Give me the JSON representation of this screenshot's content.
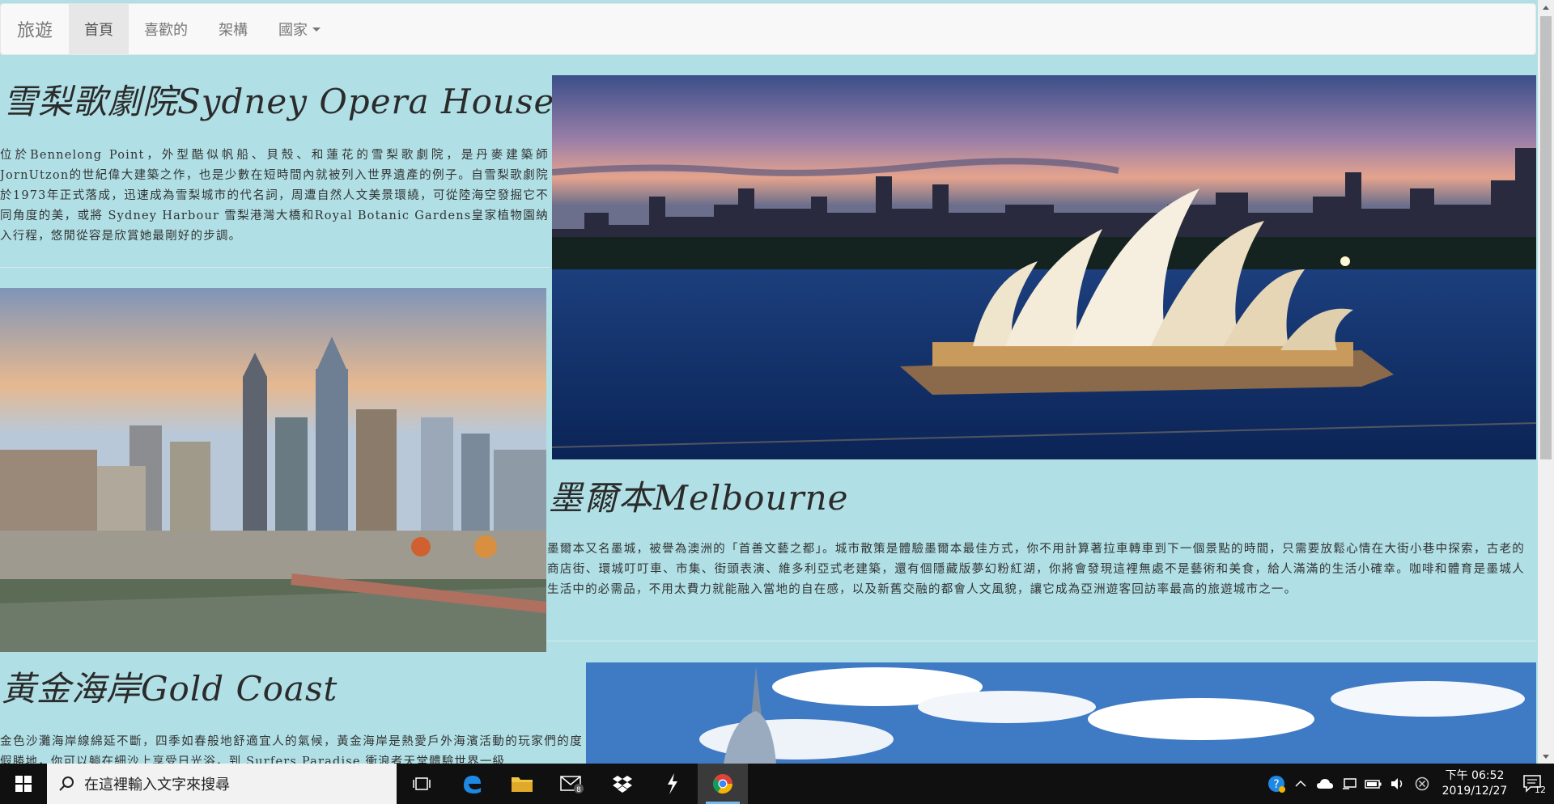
{
  "navbar": {
    "brand": "旅遊",
    "items": [
      {
        "label": "首頁",
        "active": true
      },
      {
        "label": "喜歡的",
        "active": false
      },
      {
        "label": "架構",
        "active": false
      },
      {
        "label": "國家",
        "active": false,
        "dropdown": true
      }
    ]
  },
  "sections": [
    {
      "title": "雪梨歌劇院Sydney Opera House",
      "text": "位於Bennelong Point，外型酷似帆船、貝殼、和蓮花的雪梨歌劇院，是丹麥建築師JornUtzon的世紀偉大建築之作，也是少數在短時間內就被列入世界遺產的例子。自雪梨歌劇院於1973年正式落成，迅速成為雪梨城市的代名詞，周遭自然人文美景環繞，可從陸海空發掘它不同角度的美，或將 Sydney Harbour 雪梨港灣大橋和Royal Botanic Gardens皇家植物園納入行程，悠閒從容是欣賞她最剛好的步調。",
      "image": "sydney-opera-house-photo"
    },
    {
      "title": "墨爾本Melbourne",
      "text": "墨爾本又名墨城，被譽為澳洲的「首善文藝之都」。城市散策是體驗墨爾本最佳方式，你不用計算著拉車轉車到下一個景點的時間，只需要放鬆心情在大街小巷中探索，古老的商店街、環城叮叮車、市集、街頭表演、維多利亞式老建築，還有個隱藏版夢幻粉紅湖，你將會發現這裡無處不是藝術和美食，給人滿滿的生活小確幸。咖啡和體育是墨城人生活中的必需品，不用太費力就能融入當地的自在感，以及新舊交融的都會人文風貌，讓它成為亞洲遊客回訪率最高的旅遊城市之一。",
      "image": "melbourne-skyline-photo"
    },
    {
      "title": "黃金海岸Gold Coast",
      "text": "金色沙灘海岸線綿延不斷，四季如春般地舒適宜人的氣候，黃金海岸是熱愛戶外海濱活動的玩家們的度假勝地，你可以躺在細沙上享受日光浴，到 Surfers Paradise 衝浪者天堂體驗世界一級",
      "image": "gold-coast-photo"
    }
  ],
  "taskbar": {
    "search_placeholder": "在這裡輸入文字來搜尋",
    "mail_badge": "8",
    "time": "下午 06:52",
    "date": "2019/12/27",
    "notification_count": "12"
  },
  "colors": {
    "page_background": "#b0e0e6",
    "navbar_background": "#f8f8f8",
    "taskbar_background": "#101010",
    "taskbar_accent": "#76b9ed"
  }
}
